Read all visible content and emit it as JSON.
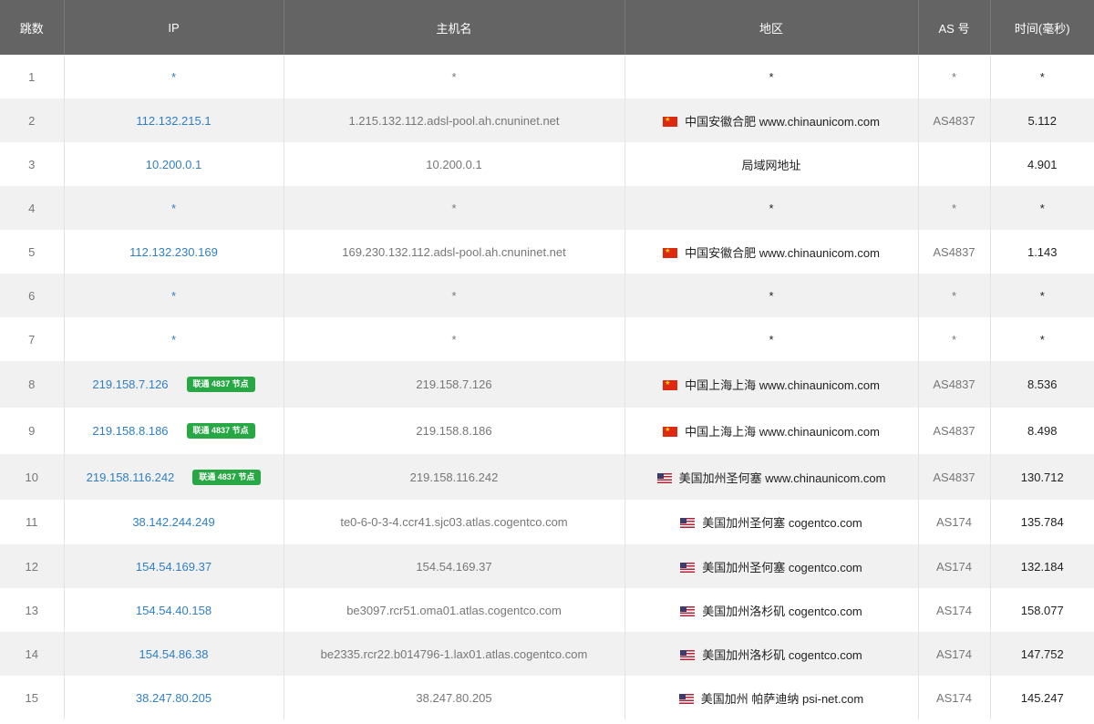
{
  "headers": [
    "跳数",
    "IP",
    "主机名",
    "地区",
    "AS 号",
    "时间(毫秒)"
  ],
  "rows": [
    {
      "hop": "1",
      "ip": "*",
      "host": "*",
      "flag": "",
      "region": "*",
      "as": "*",
      "time": "*",
      "badge": ""
    },
    {
      "hop": "2",
      "ip": "112.132.215.1",
      "host": "1.215.132.112.adsl-pool.ah.cnuninet.net",
      "flag": "cn",
      "region": "中国安徽合肥 www.chinaunicom.com",
      "as": "AS4837",
      "time": "5.112",
      "badge": ""
    },
    {
      "hop": "3",
      "ip": "10.200.0.1",
      "host": "10.200.0.1",
      "flag": "",
      "region": "局域网地址",
      "as": "",
      "time": "4.901",
      "badge": ""
    },
    {
      "hop": "4",
      "ip": "*",
      "host": "*",
      "flag": "",
      "region": "*",
      "as": "*",
      "time": "*",
      "badge": ""
    },
    {
      "hop": "5",
      "ip": "112.132.230.169",
      "host": "169.230.132.112.adsl-pool.ah.cnuninet.net",
      "flag": "cn",
      "region": "中国安徽合肥 www.chinaunicom.com",
      "as": "AS4837",
      "time": "1.143",
      "badge": ""
    },
    {
      "hop": "6",
      "ip": "*",
      "host": "*",
      "flag": "",
      "region": "*",
      "as": "*",
      "time": "*",
      "badge": ""
    },
    {
      "hop": "7",
      "ip": "*",
      "host": "*",
      "flag": "",
      "region": "*",
      "as": "*",
      "time": "*",
      "badge": ""
    },
    {
      "hop": "8",
      "ip": "219.158.7.126",
      "host": "219.158.7.126",
      "flag": "cn",
      "region": "中国上海上海 www.chinaunicom.com",
      "as": "AS4837",
      "time": "8.536",
      "badge": "联通 4837 节点"
    },
    {
      "hop": "9",
      "ip": "219.158.8.186",
      "host": "219.158.8.186",
      "flag": "cn",
      "region": "中国上海上海 www.chinaunicom.com",
      "as": "AS4837",
      "time": "8.498",
      "badge": "联通 4837 节点"
    },
    {
      "hop": "10",
      "ip": "219.158.116.242",
      "host": "219.158.116.242",
      "flag": "us",
      "region": "美国加州圣何塞 www.chinaunicom.com",
      "as": "AS4837",
      "time": "130.712",
      "badge": "联通 4837 节点"
    },
    {
      "hop": "11",
      "ip": "38.142.244.249",
      "host": "te0-6-0-3-4.ccr41.sjc03.atlas.cogentco.com",
      "flag": "us",
      "region": "美国加州圣何塞 cogentco.com",
      "as": "AS174",
      "time": "135.784",
      "badge": ""
    },
    {
      "hop": "12",
      "ip": "154.54.169.37",
      "host": "154.54.169.37",
      "flag": "us",
      "region": "美国加州圣何塞 cogentco.com",
      "as": "AS174",
      "time": "132.184",
      "badge": ""
    },
    {
      "hop": "13",
      "ip": "154.54.40.158",
      "host": "be3097.rcr51.oma01.atlas.cogentco.com",
      "flag": "us",
      "region": "美国加州洛杉矶 cogentco.com",
      "as": "AS174",
      "time": "158.077",
      "badge": ""
    },
    {
      "hop": "14",
      "ip": "154.54.86.38",
      "host": "be2335.rcr22.b014796-1.lax01.atlas.cogentco.com",
      "flag": "us",
      "region": "美国加州洛杉矶 cogentco.com",
      "as": "AS174",
      "time": "147.752",
      "badge": ""
    },
    {
      "hop": "15",
      "ip": "38.247.80.205",
      "host": "38.247.80.205",
      "flag": "us",
      "region": "美国加州 帕萨迪纳 psi-net.com",
      "as": "AS174",
      "time": "145.247",
      "badge": ""
    }
  ],
  "colors": {
    "header_bg": "#646464",
    "ip_link": "#2f7fc6",
    "badge_bg": "#27a844",
    "row_alt": "#f1f1f1"
  }
}
